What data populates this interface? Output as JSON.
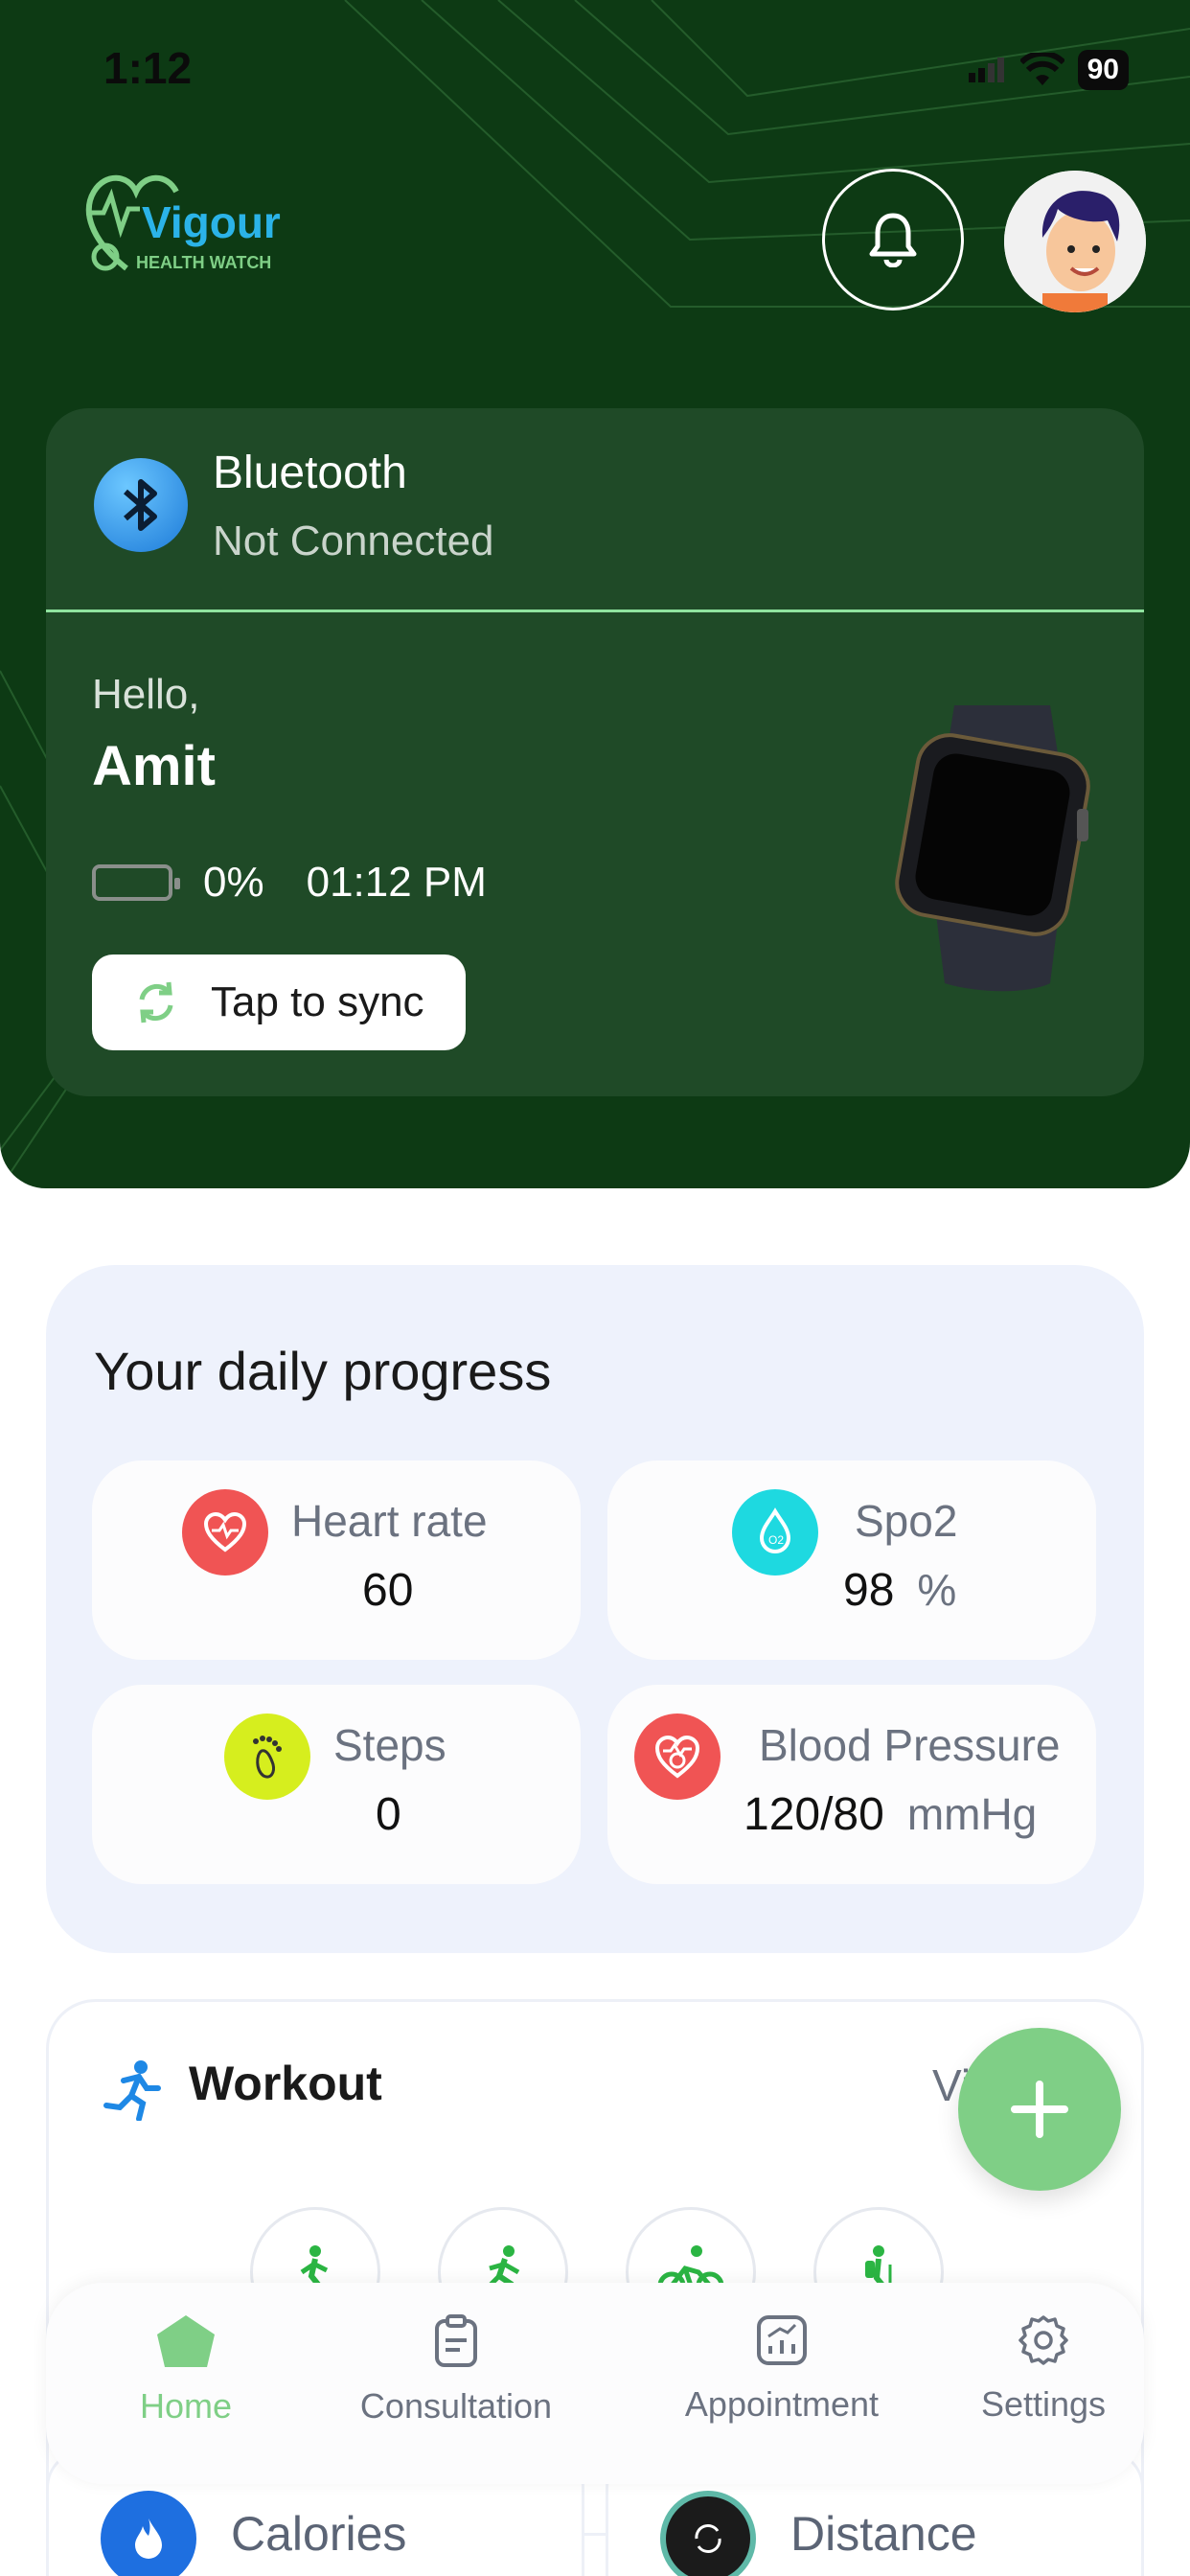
{
  "status_bar": {
    "time": "1:12",
    "battery": "90"
  },
  "logo": {
    "name": "Vigour",
    "tagline": "HEALTH WATCH"
  },
  "device": {
    "bluetooth_title": "Bluetooth",
    "bluetooth_status": "Not Connected",
    "greeting": "Hello,",
    "user_name": "Amit",
    "battery_percent": "0%",
    "sync_time": "01:12 PM",
    "sync_button": "Tap to sync"
  },
  "daily_progress": {
    "title": "Your daily progress",
    "heart_rate": {
      "label": "Heart rate",
      "value": "60"
    },
    "spo2": {
      "label": "Spo2",
      "value": "98",
      "unit": "%"
    },
    "steps": {
      "label": "Steps",
      "value": "0"
    },
    "blood_pressure": {
      "label": "Blood Pressure",
      "value": "120/80",
      "unit": "mmHg"
    }
  },
  "workout": {
    "title": "Workout",
    "view_link": "Vi"
  },
  "stats": {
    "calories": "Calories",
    "distance": "Distance"
  },
  "tabbar": {
    "home": "Home",
    "consultation": "Consultation",
    "appointment": "Appointment",
    "settings": "Settings"
  },
  "colors": {
    "header_bg": "#0d3a14",
    "card_bg": "#1f4a27",
    "accent_green": "#7fcf86",
    "heart_red": "#f05454",
    "spo2_cyan": "#1ed9e0",
    "steps_yellow": "#d6ee1e"
  }
}
